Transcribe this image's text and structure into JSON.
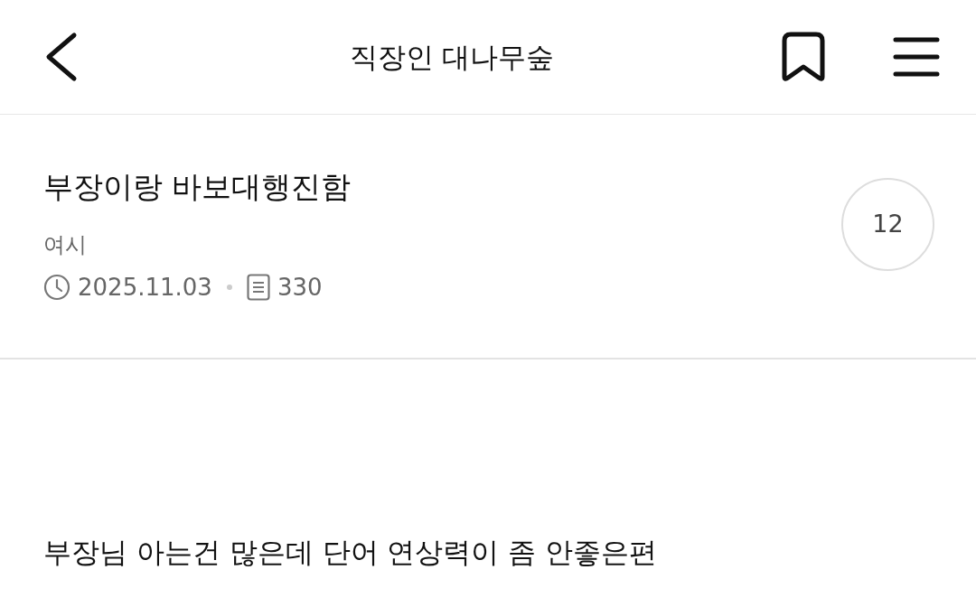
{
  "header": {
    "title": "직장인 대나무숲"
  },
  "post": {
    "title": "부장이랑 바보대행진함",
    "author": "여시",
    "date": "2025.11.03",
    "views": "330",
    "comment_count": "12"
  },
  "body": {
    "paragraphs": [
      "부장님 아는건 많은데 단어 연상력이 좀 안좋은편"
    ]
  }
}
